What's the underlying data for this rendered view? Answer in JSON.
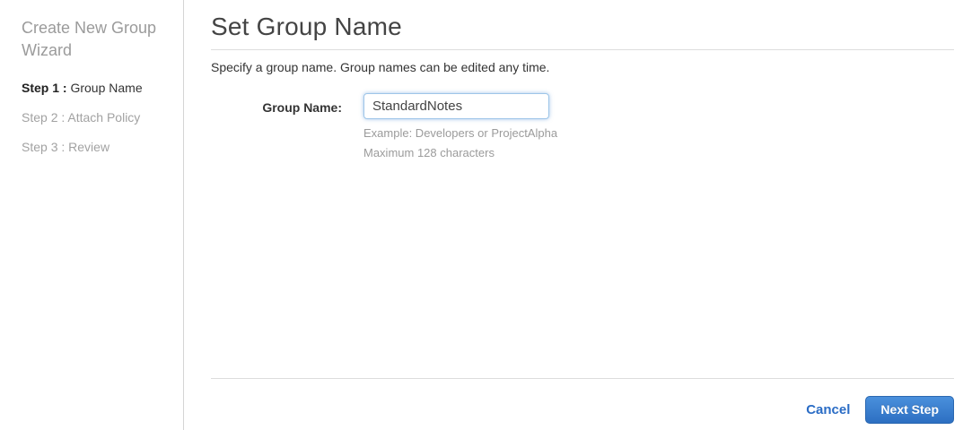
{
  "sidebar": {
    "title": "Create New Group Wizard",
    "steps": [
      {
        "prefix": "Step 1 :",
        "label": " Group Name",
        "active": true
      },
      {
        "prefix": "Step 2 :",
        "label": " Attach Policy",
        "active": false
      },
      {
        "prefix": "Step 3 :",
        "label": " Review",
        "active": false
      }
    ]
  },
  "main": {
    "title": "Set Group Name",
    "description": "Specify a group name. Group names can be edited any time.",
    "form": {
      "group_name_label": "Group Name:",
      "group_name_value": "StandardNotes",
      "hint_example": "Example: Developers or ProjectAlpha",
      "hint_max": "Maximum 128 characters"
    },
    "footer": {
      "cancel_label": "Cancel",
      "next_label": "Next Step"
    }
  },
  "colors": {
    "link_blue": "#2a6cc5",
    "button_blue_top": "#4a90dc",
    "button_blue_bottom": "#2d6fc2",
    "input_focus_border": "#9ec5e8",
    "muted_gray": "#9b9b9b",
    "divider_gray": "#dddddd"
  }
}
